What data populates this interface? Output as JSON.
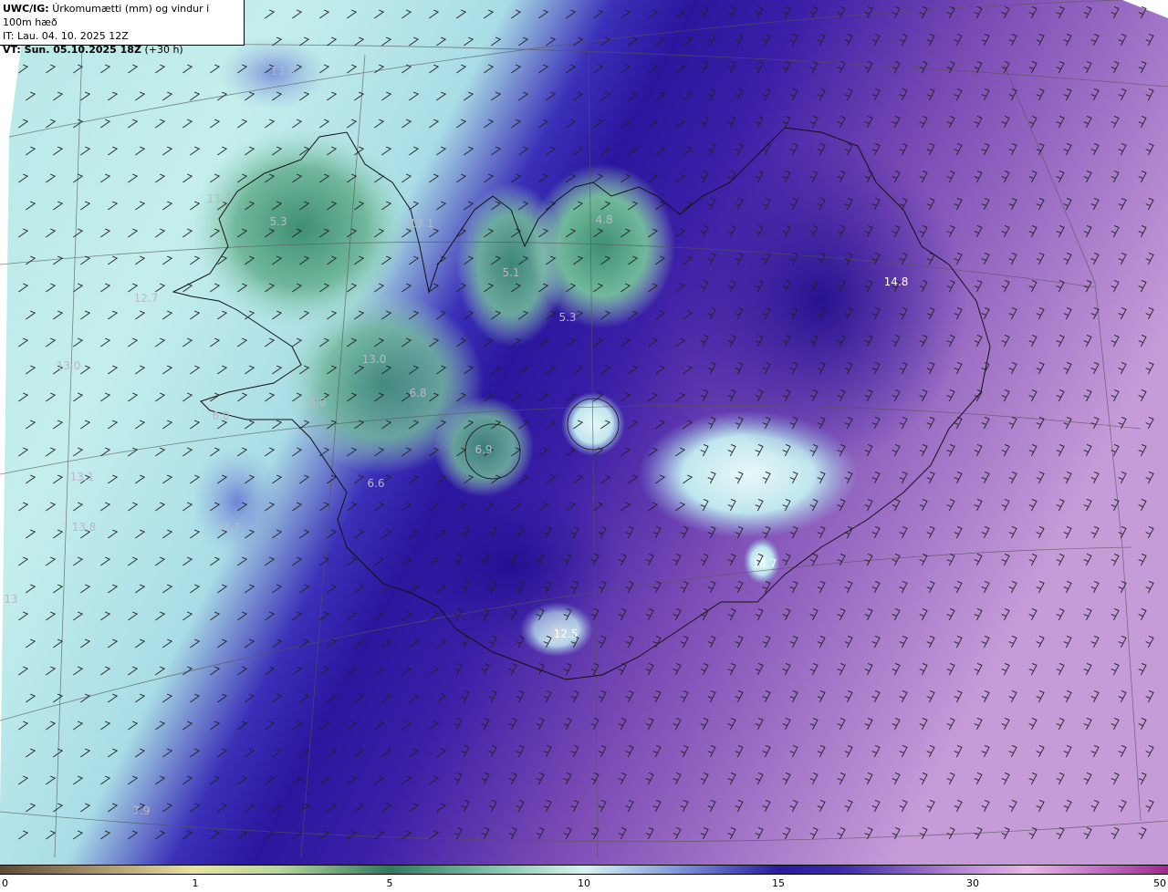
{
  "header": {
    "model": "UWC/IG:",
    "title": "Úrkomumætti (mm) og vindur i 100m hæð",
    "it_line": "IT: Lau. 04. 10. 2025 12Z",
    "vt_label": "VT: Sun. 05.10.2025 18Z",
    "vt_offset": "(+30 h)"
  },
  "map_labels": [
    {
      "text": "13.5",
      "dark": false
    },
    {
      "text": "13.3",
      "dark": false
    },
    {
      "text": "5.3",
      "dark": false
    },
    {
      "text": "13.1",
      "dark": false
    },
    {
      "text": "4.8",
      "dark": false
    },
    {
      "text": "5.1",
      "dark": false
    },
    {
      "text": "12.7",
      "dark": false
    },
    {
      "text": "5.3",
      "dark": false
    },
    {
      "text": "13.0",
      "dark": false
    },
    {
      "text": "13.0",
      "dark": false
    },
    {
      "text": "6.6",
      "dark": false
    },
    {
      "text": "6.8",
      "dark": false
    },
    {
      "text": "6.0",
      "dark": false
    },
    {
      "text": "6.9",
      "dark": false
    },
    {
      "text": "13.1",
      "dark": false
    },
    {
      "text": "6.6",
      "dark": false
    },
    {
      "text": "13.3",
      "dark": false
    },
    {
      "text": "13.8",
      "dark": false
    },
    {
      "text": "13",
      "dark": false
    },
    {
      "text": "14.8",
      "dark": true
    },
    {
      "text": "14.7",
      "dark": true
    },
    {
      "text": "12.5",
      "dark": true
    },
    {
      "text": "7.9",
      "dark": false
    }
  ],
  "colorbar": {
    "ticks": [
      "0",
      "1",
      "5",
      "10",
      "15",
      "30",
      "50"
    ]
  },
  "colors": {
    "land_green": "#3f8f72",
    "light_cyan": "#c7f0ec",
    "mid_blue": "#6f88d8",
    "deep_blue": "#28169a",
    "purple": "#9a66c0",
    "lavender": "#c49ad8"
  }
}
